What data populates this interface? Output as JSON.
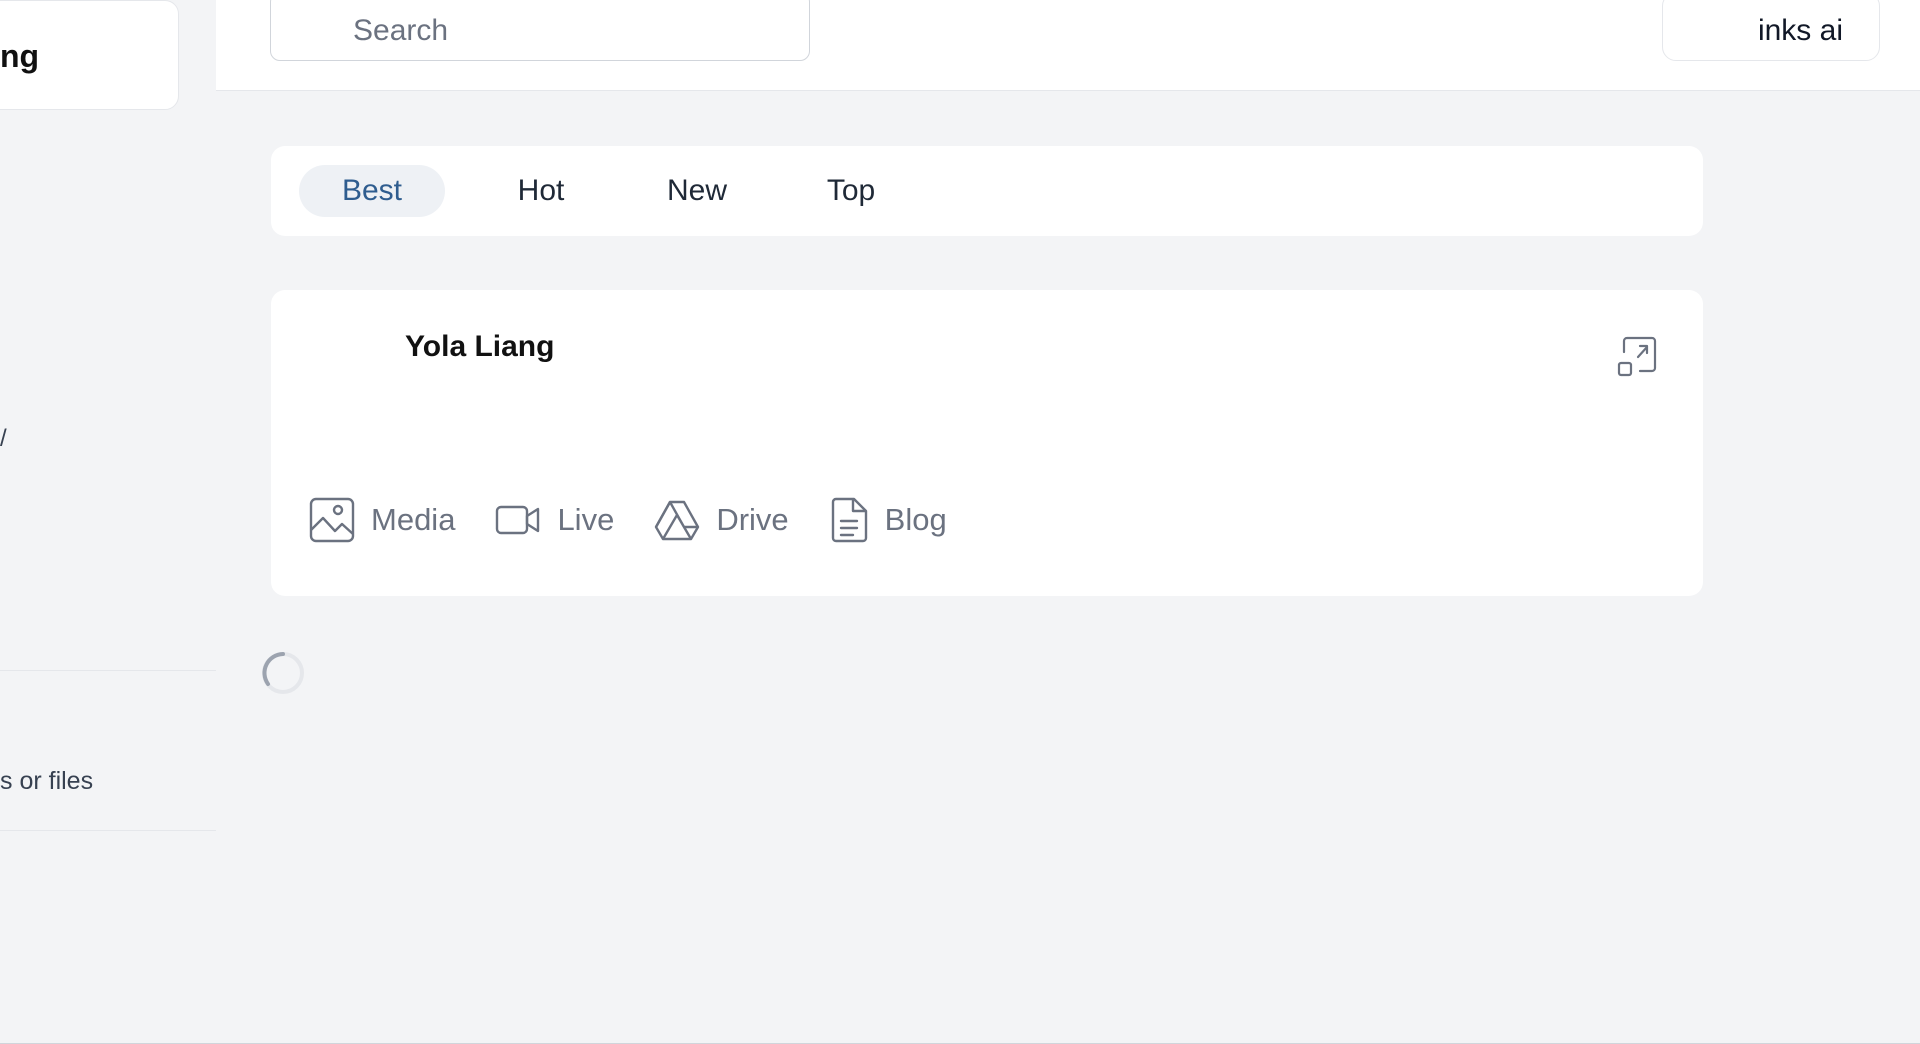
{
  "sidebar": {
    "brand_fragment": "ng",
    "text_fragment": "/",
    "drop_text": "s or files"
  },
  "search": {
    "placeholder": "Search"
  },
  "header": {
    "links_ai_label": "inks ai"
  },
  "sort_tabs": [
    {
      "label": "Best",
      "active": true
    },
    {
      "label": "Hot",
      "active": false
    },
    {
      "label": "New",
      "active": false
    },
    {
      "label": "Top",
      "active": false
    }
  ],
  "composer": {
    "user_name": "Yola Liang",
    "actions": [
      {
        "label": "Media",
        "icon": "image-icon"
      },
      {
        "label": "Live",
        "icon": "video-camera-icon"
      },
      {
        "label": "Drive",
        "icon": "drive-icon"
      },
      {
        "label": "Blog",
        "icon": "document-icon"
      }
    ]
  },
  "colors": {
    "background": "#f3f4f6",
    "card": "#ffffff",
    "active_tab_text": "#2f5d8f",
    "active_tab_bg": "#eef1f5",
    "muted_text": "#6b7280"
  }
}
